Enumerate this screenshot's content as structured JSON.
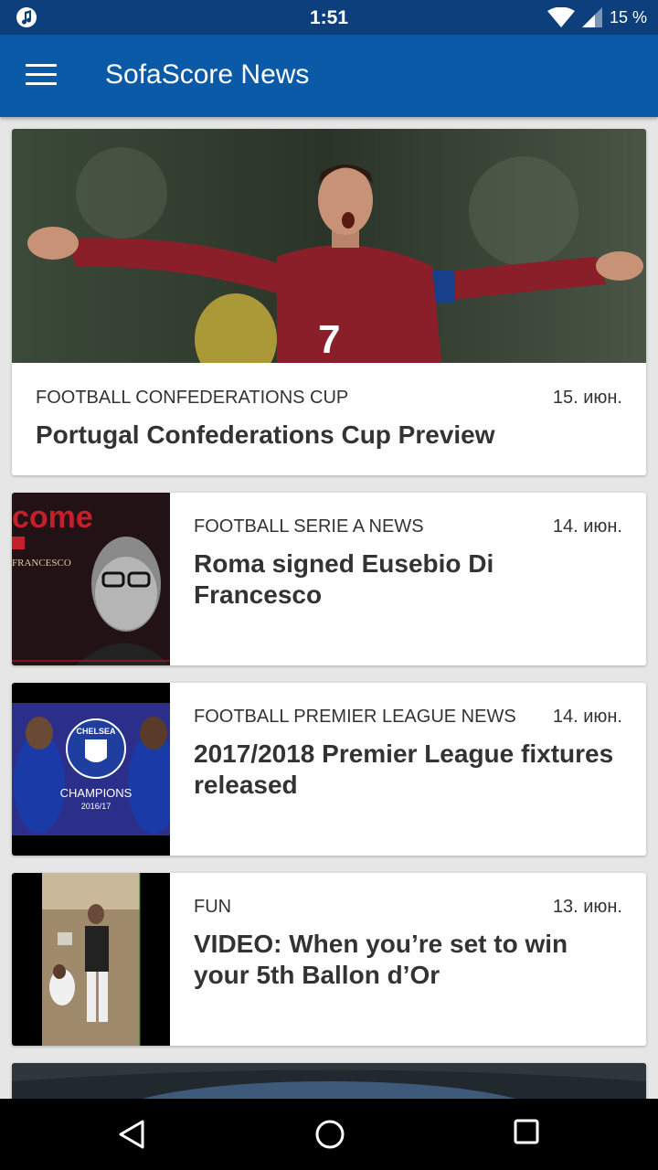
{
  "status_bar": {
    "time": "1:51",
    "battery": "15 %"
  },
  "app_bar": {
    "title": "SofaScore News"
  },
  "colors": {
    "status_bar": "#0d3f7c",
    "app_bar": "#0a5aa8",
    "background": "#e6e6e6"
  },
  "articles": [
    {
      "category": "FOOTBALL CONFEDERATIONS CUP",
      "date": "15. июн.",
      "title": "Portugal Confederations Cup Preview"
    },
    {
      "category": "FOOTBALL SERIE A NEWS",
      "date": "14. июн.",
      "title": "Roma signed Eusebio Di Francesco",
      "thumb_text": "come",
      "thumb_sub": "FRANCESCO"
    },
    {
      "category": "FOOTBALL PREMIER LEAGUE NEWS",
      "date": "14. июн.",
      "title": "2017/2018 Premier League fixtures released",
      "thumb_badge": "CHELSEA",
      "thumb_text": "CHAMPIONS",
      "thumb_sub": "2016/17"
    },
    {
      "category": "FUN",
      "date": "13. июн.",
      "title": "VIDEO: When you’re set to win your 5th Ballon d’Or"
    }
  ]
}
